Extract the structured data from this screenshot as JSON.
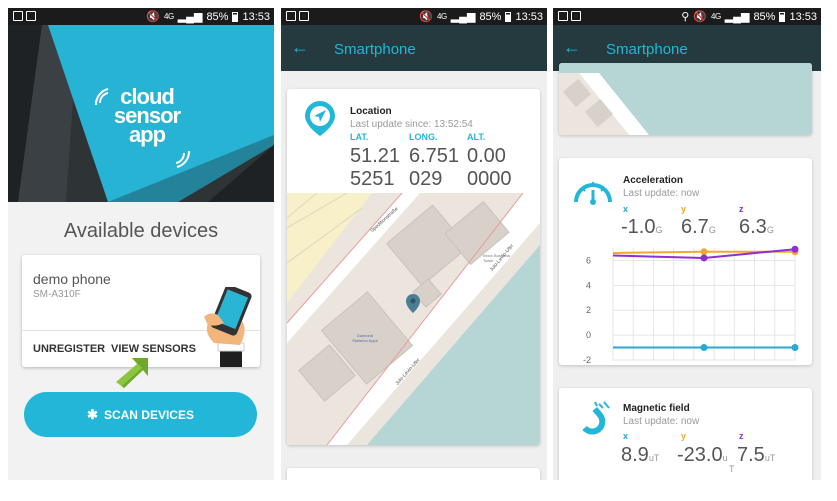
{
  "status": {
    "battery": "85%",
    "time": "13:53",
    "net_type": "4G"
  },
  "screen1": {
    "logo": {
      "line1": "cloud",
      "line2": "sensor",
      "line3": "app"
    },
    "available_title": "Available devices",
    "device": {
      "name": "demo phone",
      "model": "SM-A310F"
    },
    "unregister_label": "UNREGISTER",
    "view_sensors_label": "VIEW SENSORS",
    "scan_label": "SCAN DEVICES"
  },
  "screen2": {
    "appbar_title": "Smartphone",
    "location": {
      "title": "Location",
      "last_update": "Last update since: 13:52:54",
      "lat_label": "LAT.",
      "long_label": "LONG.",
      "alt_label": "ALT.",
      "lat_line1": "51.21",
      "lat_line2": "5251",
      "long_line1": "6.751",
      "long_line2": "029",
      "alt_line1": "0.00",
      "alt_line2": "0000"
    },
    "map": {
      "street1": "Speditionstraße",
      "street2": "Julo-Levin-Ufer",
      "street3": "Julo-Levin-Ufer",
      "poi1": "Daimond Skeleton Apps",
      "poi2": "Inbox Business Tower"
    }
  },
  "screen3": {
    "appbar_title": "Smartphone",
    "acceleration": {
      "title": "Acceleration",
      "last_update": "Last update: now",
      "x_label": "x",
      "y_label": "y",
      "z_label": "z",
      "x_value": "-1.0",
      "y_value": "6.7",
      "z_value": "6.3",
      "unit": "G"
    },
    "magnetic": {
      "title": "Magnetic field",
      "last_update": "Last update: now",
      "x_label": "x",
      "y_label": "y",
      "z_label": "z",
      "x_value": "8.9",
      "y_value": "-23.0",
      "z_value": "7.5",
      "x_unit": "uT",
      "y_unit_1": "u",
      "y_unit_2": "T",
      "z_unit": "uT"
    }
  },
  "colors": {
    "accent": "#22b7d8",
    "appbar": "#243a3f",
    "series_x": "#29a8d1",
    "series_y": "#f0a830",
    "series_z": "#8e2fd6"
  },
  "chart_data": {
    "type": "line",
    "title": "",
    "x": [
      0,
      1,
      2
    ],
    "series": [
      {
        "values": [
          -1.0,
          -1.0,
          -1.0
        ],
        "color": "#29a8d1"
      },
      {
        "values": [
          6.6,
          6.7,
          6.7
        ],
        "color": "#f0a830"
      },
      {
        "values": [
          6.4,
          6.2,
          6.9
        ],
        "color": "#8e2fd6"
      }
    ],
    "y_ticks": [
      "6",
      "4",
      "2",
      "0",
      "-2"
    ],
    "ylim": [
      -2,
      7
    ],
    "grid": true
  }
}
